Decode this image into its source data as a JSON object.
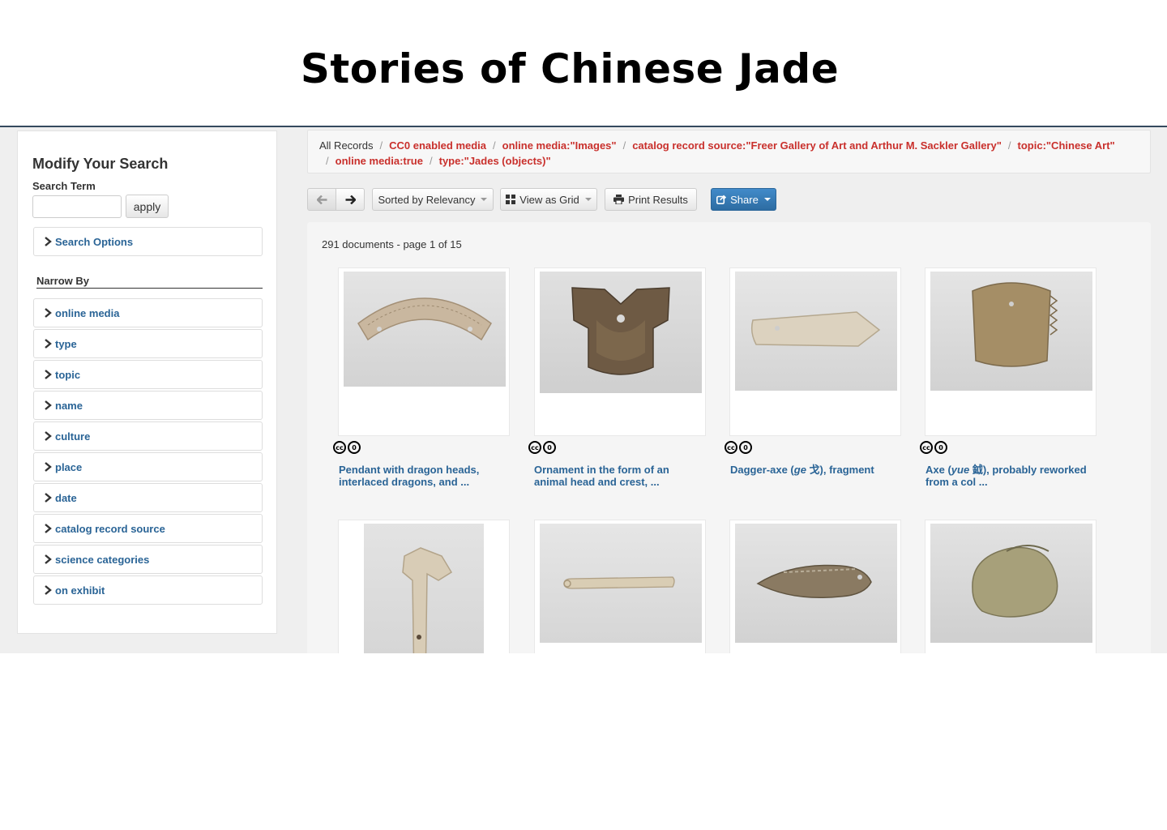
{
  "page_title": "Stories of Chinese Jade",
  "sidebar": {
    "heading": "Modify Your Search",
    "search_term_label": "Search Term",
    "search_input_value": "",
    "apply_label": "apply",
    "search_options_label": "Search Options",
    "narrow_by_label": "Narrow By",
    "facets": [
      "online media",
      "type",
      "topic",
      "name",
      "culture",
      "place",
      "date",
      "catalog record source",
      "science categories",
      "on exhibit"
    ]
  },
  "breadcrumb": {
    "first": "All Records",
    "crumbs": [
      "CC0 enabled media",
      "online media:\"Images\"",
      "catalog record source:\"Freer Gallery of Art and Arthur M. Sackler Gallery\"",
      "topic:\"Chinese Art\"",
      "online media:true",
      "type:\"Jades (objects)\""
    ]
  },
  "toolbar": {
    "sort_label": "Sorted by Relevancy",
    "view_label": "View as Grid",
    "print_label": "Print Results",
    "share_label": "Share"
  },
  "results": {
    "count_text": "291 documents - page 1 of 15",
    "items": [
      {
        "title_line1": "Pendant with dragon heads,",
        "title_line2": "interlaced dragons, and ...",
        "image": "jade-pendant-arc",
        "license": "CC0"
      },
      {
        "title_line1": "Ornament in the form of an",
        "title_line2": "animal head and crest, ...",
        "image": "jade-ornament-animal-head",
        "license": "CC0"
      },
      {
        "title_pre": "Dagger-axe (",
        "title_italic": "ge",
        "title_post": " 戈), fragment",
        "title_line2": "",
        "image": "jade-dagger-axe",
        "license": "CC0"
      },
      {
        "title_pre": "Axe (",
        "title_italic": "yue",
        "title_post": " 鉞), probably reworked",
        "title_line2": "from a col ...",
        "image": "jade-axe-yue",
        "license": "CC0"
      },
      {
        "image": "jade-ceremonial-blade"
      },
      {
        "image": "jade-rod-pin"
      },
      {
        "image": "jade-fish-blade"
      },
      {
        "image": "jade-animal-figure"
      }
    ]
  },
  "colors": {
    "link": "#2a6496",
    "crumb": "#c9302c",
    "share": "#2d6ca2"
  }
}
